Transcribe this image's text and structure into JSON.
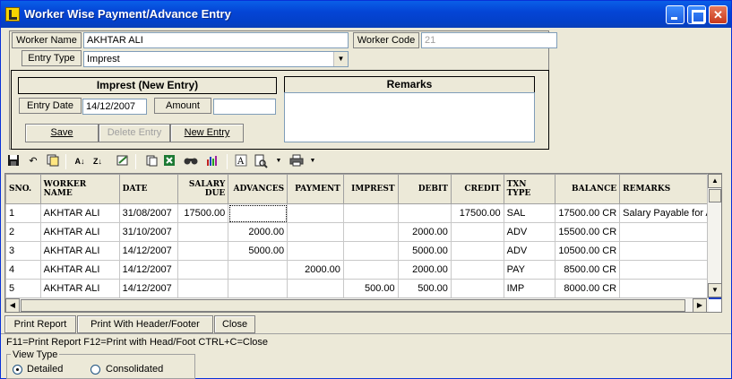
{
  "window": {
    "title": "Worker Wise Payment/Advance Entry"
  },
  "header": {
    "worker_name_label": "Worker Name",
    "worker_name_value": "AKHTAR ALI",
    "worker_code_label": "Worker Code",
    "worker_code_value": "21",
    "entry_type_label": "Entry Type",
    "entry_type_value": "Imprest"
  },
  "entry_panel": {
    "title": "Imprest (New Entry)",
    "entry_date_label": "Entry Date",
    "entry_date_value": "14/12/2007",
    "amount_label": "Amount",
    "amount_value": "",
    "save_label": "Save",
    "delete_label": "Delete Entry",
    "new_label": "New Entry"
  },
  "remarks_panel": {
    "title": "Remarks",
    "value": ""
  },
  "toolbar": {
    "icons": [
      "save-icon",
      "undo-icon",
      "copy-icon",
      "sort-asc-icon",
      "sort-desc-icon",
      "filter-icon",
      "paste-icon",
      "excel-icon",
      "find-icon",
      "chart-icon",
      "font-icon",
      "print-preview-icon",
      "print-icon"
    ]
  },
  "grid": {
    "columns": [
      "SNO.",
      "WORKER NAME",
      "DATE",
      "SALARY DUE",
      "ADVANCES",
      "PAYMENT",
      "IMPREST",
      "DEBIT",
      "CREDIT",
      "TXN TYPE",
      "BALANCE",
      "REMARKS"
    ],
    "rows": [
      [
        "1",
        "AKHTAR ALI",
        "31/08/2007",
        "17500.00",
        "",
        "",
        "",
        "",
        "17500.00",
        "SAL",
        "17500.00 CR",
        "Salary Payable for Au"
      ],
      [
        "2",
        "AKHTAR ALI",
        "31/10/2007",
        "",
        "2000.00",
        "",
        "",
        "2000.00",
        "",
        "ADV",
        "15500.00 CR",
        ""
      ],
      [
        "3",
        "AKHTAR ALI",
        "14/12/2007",
        "",
        "5000.00",
        "",
        "",
        "5000.00",
        "",
        "ADV",
        "10500.00 CR",
        ""
      ],
      [
        "4",
        "AKHTAR ALI",
        "14/12/2007",
        "",
        "",
        "2000.00",
        "",
        "2000.00",
        "",
        "PAY",
        "8500.00 CR",
        ""
      ],
      [
        "5",
        "AKHTAR ALI",
        "14/12/2007",
        "",
        "",
        "",
        "500.00",
        "500.00",
        "",
        "IMP",
        "8000.00 CR",
        ""
      ]
    ]
  },
  "bottom_buttons": {
    "print_report": "Print Report",
    "print_header_footer": "Print With Header/Footer",
    "close": "Close"
  },
  "status": "F11=Print Report  F12=Print with Head/Foot  CTRL+C=Close",
  "view_type": {
    "legend": "View Type",
    "detailed": "Detailed",
    "consolidated": "Consolidated",
    "selected": "Detailed"
  }
}
